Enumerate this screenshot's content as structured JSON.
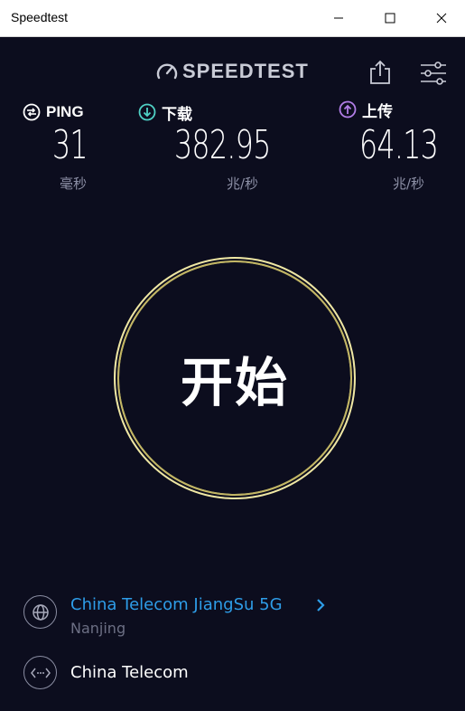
{
  "window": {
    "title": "Speedtest"
  },
  "header": {
    "logo_text": "SPEEDTEST"
  },
  "metrics": {
    "ping": {
      "label": "PING",
      "value": "31",
      "unit": "毫秒"
    },
    "download": {
      "label": "下载",
      "value": "382.95",
      "unit": "兆/秒"
    },
    "upload": {
      "label": "上传",
      "value": "64.13",
      "unit": "兆/秒"
    }
  },
  "go_button": {
    "label": "开始"
  },
  "server": {
    "name": "China Telecom JiangSu 5G",
    "location": "Nanjing"
  },
  "isp": {
    "name": "China Telecom"
  },
  "colors": {
    "background": "#0c0d1e",
    "accent_blue": "#2e9de8",
    "go_ring": "#efe7a4",
    "download_icon": "#4fd1c5",
    "upload_icon": "#b27ee8",
    "muted_text": "#8d90a6"
  }
}
